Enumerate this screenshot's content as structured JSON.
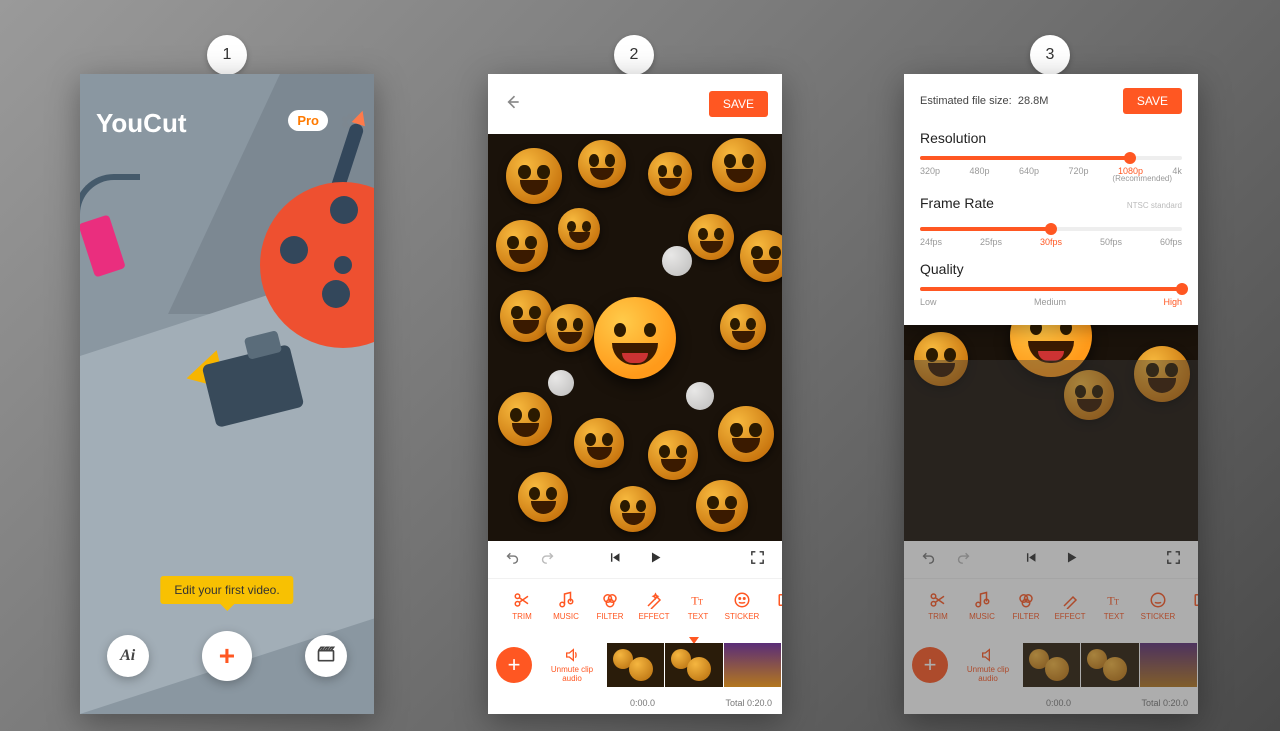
{
  "badges": {
    "one": "1",
    "two": "2",
    "three": "3"
  },
  "home": {
    "logo": "YouCut",
    "pro": "Pro",
    "tooltip": "Edit your first video.",
    "ai_label": "Ai"
  },
  "editor": {
    "save": "SAVE",
    "tools": {
      "trim": "TRIM",
      "music": "MUSIC",
      "filter": "FILTER",
      "effect": "EFFECT",
      "text": "TEXT",
      "sticker": "STICKER",
      "pip": "P"
    },
    "unmute_l1": "Unmute clip",
    "unmute_l2": "audio",
    "time_start": "0:00.0",
    "time_total": "Total 0:20.0"
  },
  "export": {
    "est_label": "Estimated file size:",
    "est_value": "28.8M",
    "save": "SAVE",
    "resolution_title": "Resolution",
    "res_ticks": {
      "r320": "320p",
      "r480": "480p",
      "r640": "640p",
      "r720": "720p",
      "r1080": "1080p",
      "r4k": "4k"
    },
    "recommended": "(Recommended)",
    "framerate_title": "Frame Rate",
    "ntsc": "NTSC standard",
    "fr_ticks": {
      "f24": "24fps",
      "f25": "25fps",
      "f30": "30fps",
      "f50": "50fps",
      "f60": "60fps"
    },
    "quality_title": "Quality",
    "q_ticks": {
      "low": "Low",
      "med": "Medium",
      "high": "High"
    }
  }
}
